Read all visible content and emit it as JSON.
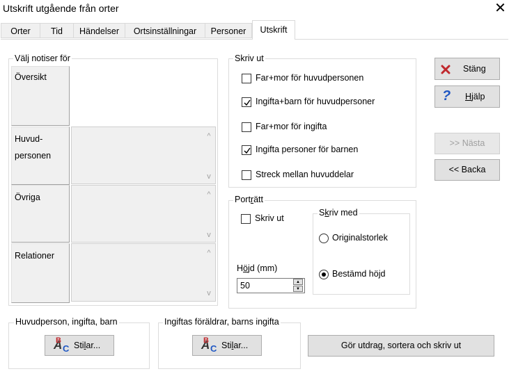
{
  "window": {
    "title": "Utskrift utgående från orter",
    "close_glyph": "✕"
  },
  "tabs": [
    {
      "label": "Orter"
    },
    {
      "label": "Tid"
    },
    {
      "label": "Händelser"
    },
    {
      "label": "Ortsinställningar"
    },
    {
      "label": "Personer"
    },
    {
      "label": "Utskrift",
      "active": true
    }
  ],
  "notices": {
    "group_label": "Välj notiser för",
    "rows": [
      {
        "label": "Översikt",
        "enabled": true
      },
      {
        "label_line1": "Huvud-",
        "label_line2": "personen",
        "enabled": false
      },
      {
        "label": "Övriga",
        "enabled": false
      },
      {
        "label": "Relationer",
        "enabled": false
      }
    ],
    "scroll_up": "^",
    "scroll_down": "v"
  },
  "print": {
    "group_label": "Skriv ut",
    "options": [
      {
        "label": "Far+mor för huvudpersonen",
        "checked": false
      },
      {
        "label": "Ingifta+barn för huvudpersoner",
        "checked": true
      },
      {
        "label": "Far+mor för ingifta",
        "checked": false
      },
      {
        "label": "Ingifta personer för barnen",
        "checked": true
      },
      {
        "label": "Streck mellan huvuddelar",
        "checked": false
      }
    ]
  },
  "portrait": {
    "group_label_pre": "Port",
    "group_label_u": "r",
    "group_label_post": "ätt",
    "print_label": "Skriv ut",
    "print_checked": false,
    "height_label_pre": "H",
    "height_label_u": "ö",
    "height_label_post": "jd (mm)",
    "height_value": "50",
    "write_with": {
      "label_pre": "S",
      "label_u": "k",
      "label_post": "riv med",
      "options": [
        {
          "label": "Originalstorlek",
          "selected": false
        },
        {
          "label": "Bestämd höjd",
          "selected": true
        }
      ]
    }
  },
  "side_buttons": {
    "close": {
      "label": "Stäng",
      "icon": "red-x-icon"
    },
    "help": {
      "label_u": "H",
      "label_rest": "jälp",
      "icon": "question-icon"
    },
    "next": {
      "label": ">> Nästa",
      "enabled": false
    },
    "back": {
      "label": "<< Backa",
      "enabled": true
    }
  },
  "bottom": {
    "group1_label": "Huvudperson, ingifta, barn",
    "group2_label": "Ingiftas föräldrar, barns ingifta",
    "styles_label_pre": "Sti",
    "styles_label_u": "l",
    "styles_label_post": "ar...",
    "run_label": "Gör utdrag, sortera och skriv ut"
  },
  "colors": {
    "accent_red": "#c0282d",
    "help_blue": "#1f57c3",
    "disabled_text": "#a0a0a0"
  }
}
